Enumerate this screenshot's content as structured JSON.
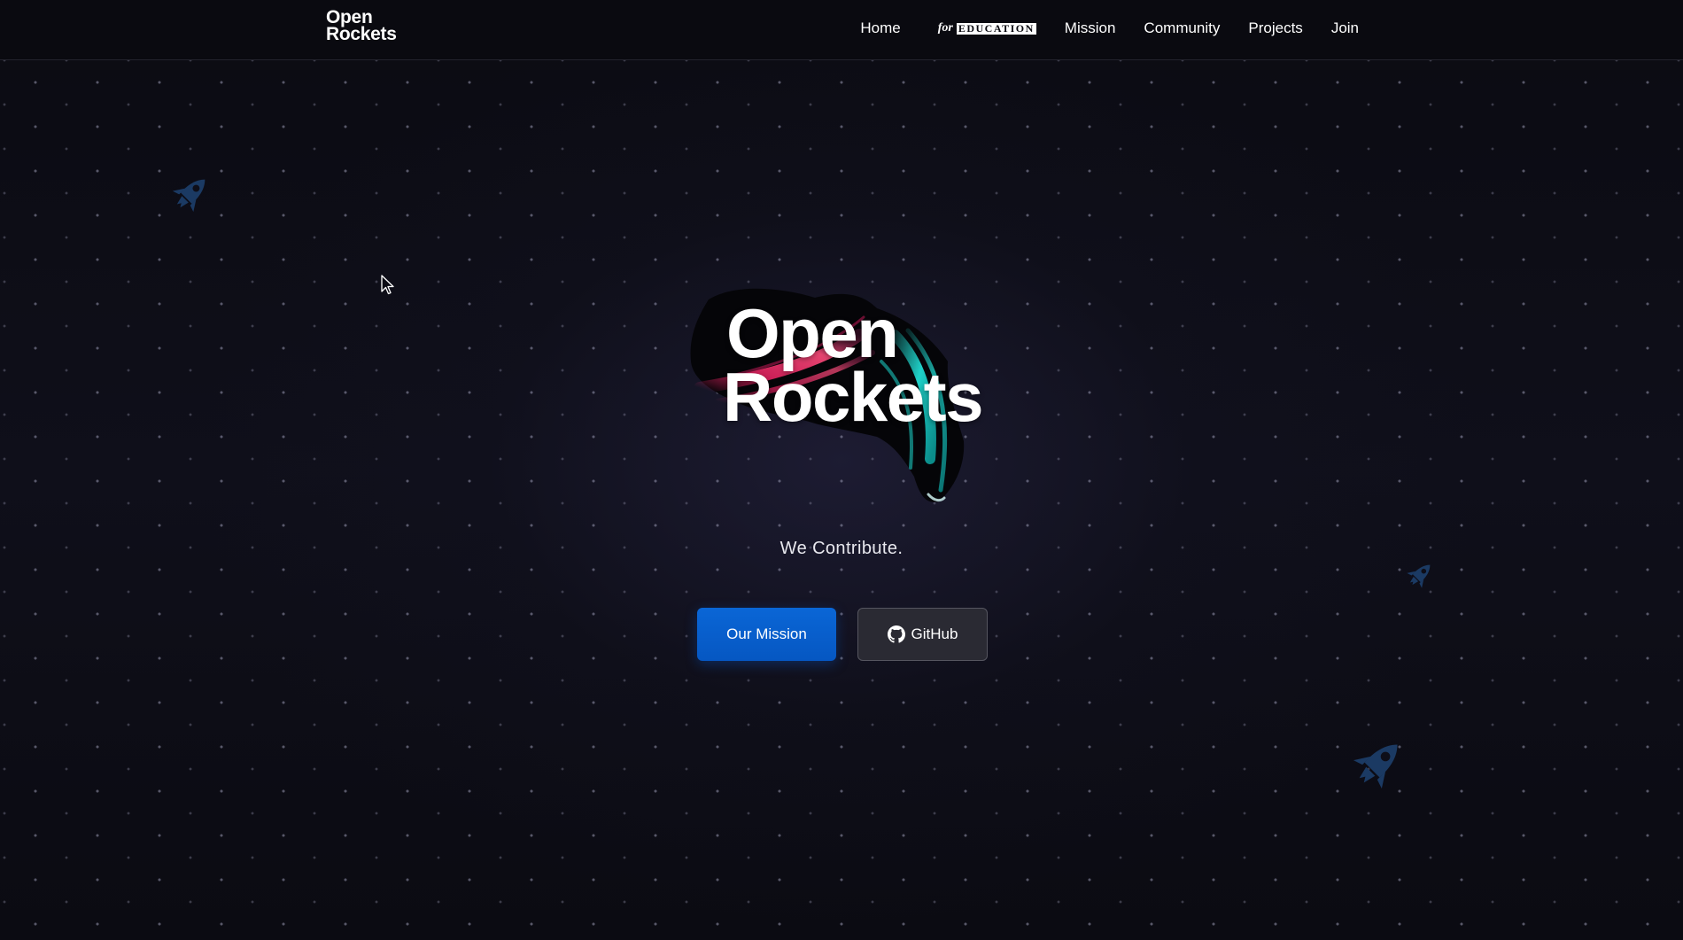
{
  "header": {
    "brand": {
      "line1": "Open",
      "line2": "Rockets"
    },
    "nav": [
      {
        "id": "home",
        "label": "Home"
      },
      {
        "id": "education",
        "prefix": "for",
        "label": "EDUCATION"
      },
      {
        "id": "mission",
        "label": "Mission"
      },
      {
        "id": "community",
        "label": "Community"
      },
      {
        "id": "projects",
        "label": "Projects"
      },
      {
        "id": "join",
        "label": "Join"
      }
    ]
  },
  "hero": {
    "title_line1": "Open",
    "title_line2": "Rockets",
    "tagline": "We Contribute.",
    "primary_button": "Our Mission",
    "secondary_button": "GitHub",
    "secondary_icon": "github-icon"
  },
  "decor": {
    "rocket_icon": "rocket-icon",
    "rocket_color": "#1b3a63",
    "dot_color": "#9696af",
    "accent_pink": "#e0215f",
    "accent_cyan": "#1fd1c8",
    "primary_button_color": "#0a66d6"
  }
}
